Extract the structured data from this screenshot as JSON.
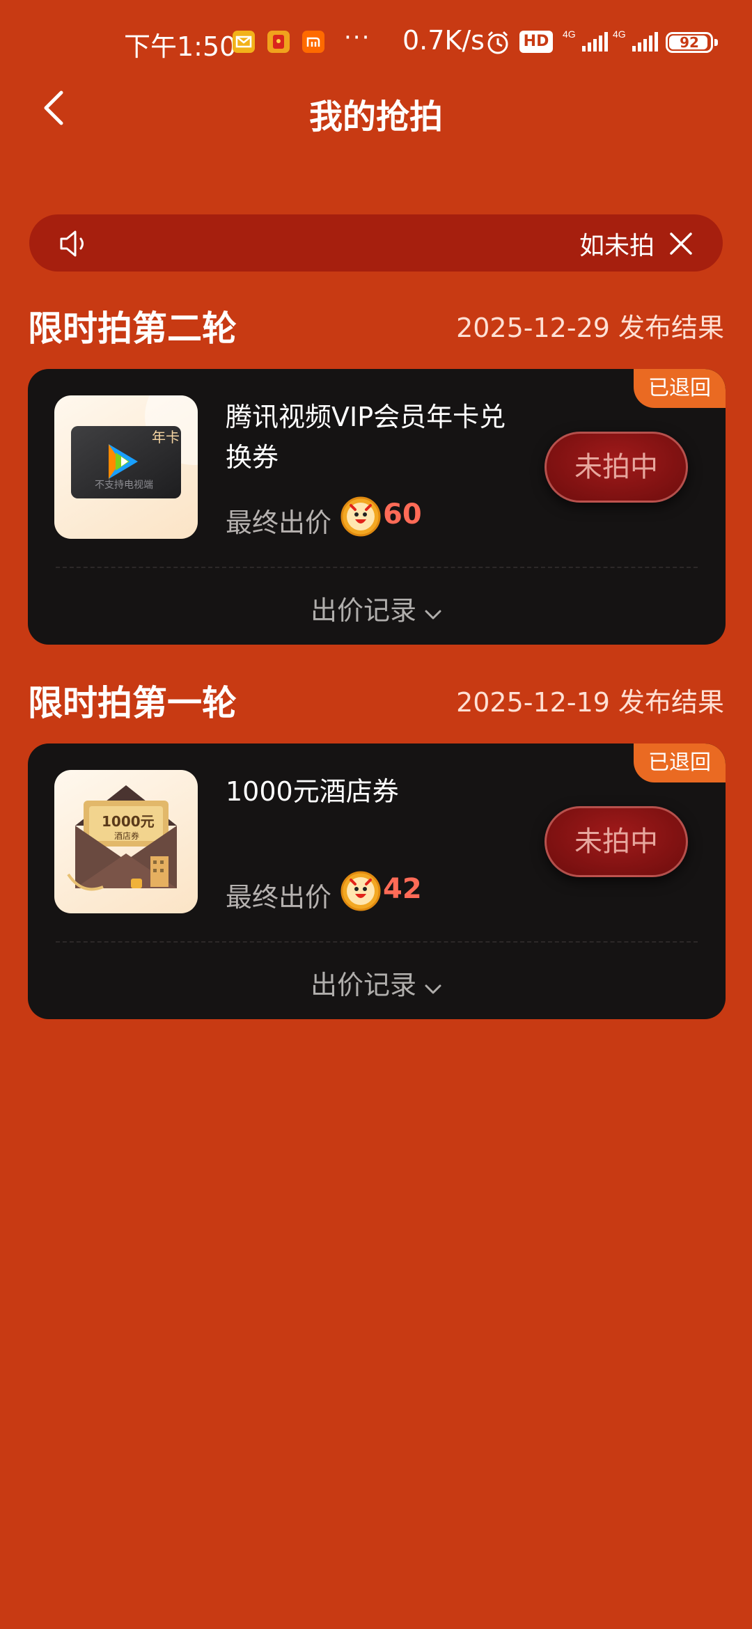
{
  "status_bar": {
    "time": "下午1:50",
    "dots": "···",
    "network_speed": "0.7K/s",
    "hd_label": "HD",
    "signal_label": "4G",
    "battery": "92"
  },
  "nav": {
    "title": "我的抢拍"
  },
  "notice": {
    "text": "如未拍"
  },
  "sections": [
    {
      "title": "限时拍第二轮",
      "date": "2025-12-29 发布结果",
      "card": {
        "badge": "已退回",
        "product_title": "腾讯视频VIP会员年卡兑换券",
        "thumb_tag": "年卡",
        "thumb_caption": "不支持电视端",
        "bid_label": "最终出价",
        "bid_value": "60",
        "status": "未拍中",
        "record_label": "出价记录"
      }
    },
    {
      "title": "限时拍第一轮",
      "date": "2025-12-19 发布结果",
      "card": {
        "badge": "已退回",
        "product_title": "1000元酒店券",
        "thumb_amount": "1000元",
        "thumb_caption": "酒店券",
        "bid_label": "最终出价",
        "bid_value": "42",
        "status": "未拍中",
        "record_label": "出价记录"
      }
    }
  ],
  "colors": {
    "background": "#c83a13",
    "card": "#151313",
    "badge": "#ea6a22",
    "bid_value": "#ff6b57",
    "notice_bar": "#a61f0e"
  }
}
